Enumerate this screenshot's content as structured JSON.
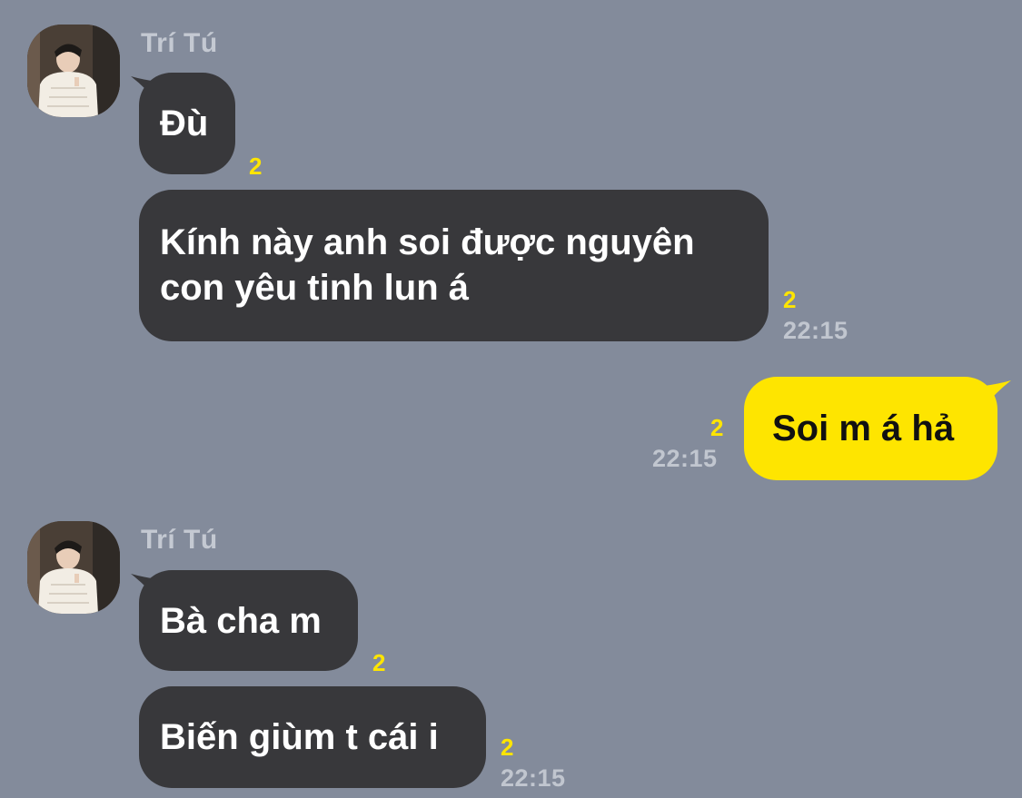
{
  "colors": {
    "background": "#838b9b",
    "incoming_bubble": "#38383b",
    "outgoing_bubble": "#fee500",
    "unread_count": "#fee500",
    "timestamp": "#c1c6cf",
    "sender_name": "#c4c9d2"
  },
  "groups": [
    {
      "sender": "Trí Tú",
      "avatar_icon": "profile-photo",
      "messages": [
        {
          "text": "Đù",
          "unread": "2",
          "time": ""
        },
        {
          "lines": [
            "Kính này anh soi được nguyên",
            "con yêu tinh lun á"
          ],
          "unread": "2",
          "time": "22:15"
        }
      ]
    },
    {
      "outgoing": true,
      "messages": [
        {
          "text": "Soi m á hả",
          "unread": "2",
          "time": "22:15"
        }
      ]
    },
    {
      "sender": "Trí Tú",
      "avatar_icon": "profile-photo",
      "messages": [
        {
          "text": "Bà cha m",
          "unread": "2",
          "time": ""
        },
        {
          "text": "Biến giùm t cái i",
          "unread": "2",
          "time": "22:15"
        }
      ]
    }
  ]
}
